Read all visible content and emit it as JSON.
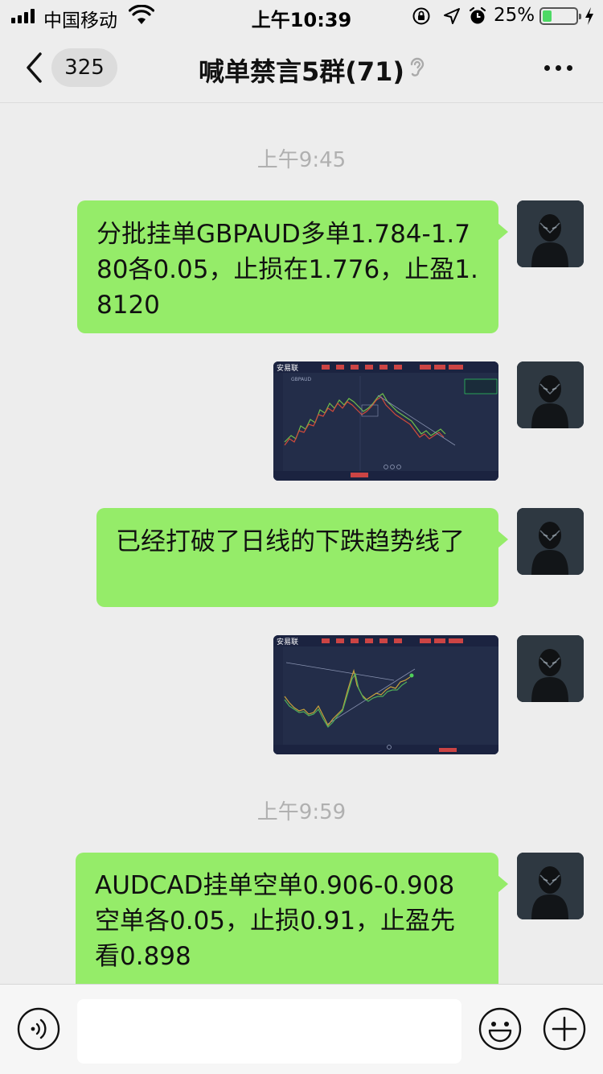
{
  "status_bar": {
    "carrier": "中国移动",
    "time": "上午10:39",
    "battery_percent": "25%",
    "battery_level": 0.25,
    "icons": [
      "signal-icon",
      "wifi-icon",
      "orientation-lock-icon",
      "location-icon",
      "alarm-icon",
      "battery-icon",
      "charging-icon"
    ]
  },
  "nav": {
    "unread_count": "325",
    "title": "喊单禁言5群(71)",
    "icons": [
      "back-chevron-icon",
      "ear-icon",
      "more-icon"
    ]
  },
  "messages": {
    "ts1": "上午9:45",
    "m1": "分批挂单GBPAUD多单1.784-1.780各0.05，止损在1.776，止盈1.8120",
    "chart1": {
      "app_name": "安易联",
      "pair": "GBPAUD"
    },
    "m2": "已经打破了日线的下跌趋势线了",
    "chart2": {
      "app_name": "安易联"
    },
    "ts2": "上午9:59",
    "m3": "AUDCAD挂单空单0.906-0.908空单各0.05，止损0.91，止盈先看0.898"
  },
  "input_bar": {
    "placeholder": "",
    "icons": [
      "voice-icon",
      "emoji-icon",
      "plus-icon"
    ]
  },
  "colors": {
    "bubble": "#95ec69",
    "background": "#ededed",
    "chart_bg": "#232d49",
    "battery_fill": "#4cd964"
  }
}
